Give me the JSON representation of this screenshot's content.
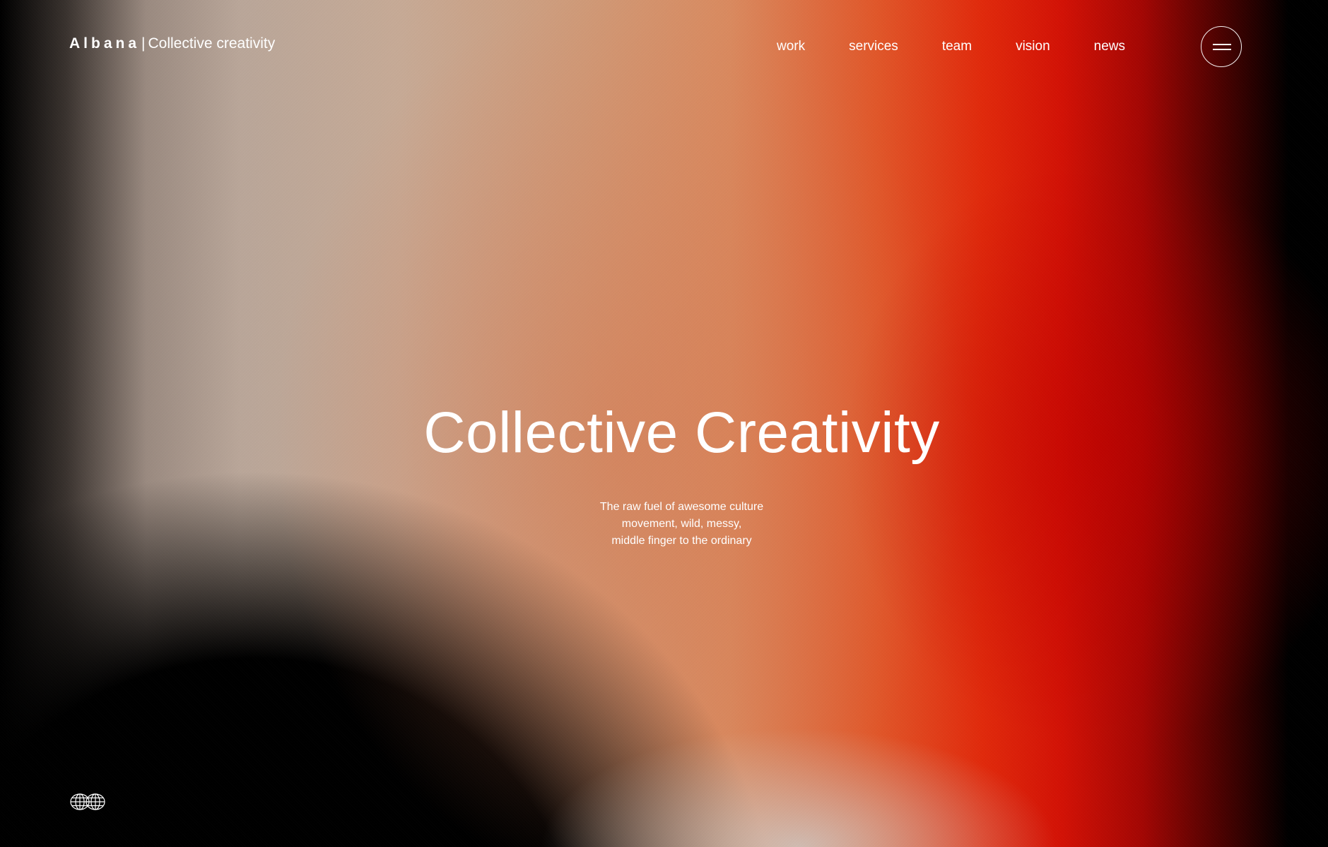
{
  "header": {
    "brand_name": "Albana",
    "brand_separator": "|",
    "brand_tagline": "Collective creativity",
    "nav": [
      {
        "label": "work"
      },
      {
        "label": "services"
      },
      {
        "label": "team"
      },
      {
        "label": "vision"
      },
      {
        "label": "news"
      }
    ],
    "menu_icon": "hamburger-icon"
  },
  "hero": {
    "title": "Collective Creativity",
    "subtitle_lines": [
      "The raw fuel of awesome culture",
      "movement, wild, messy,",
      "middle finger to the ordinary"
    ]
  },
  "footer": {
    "icon": "globe-icon"
  },
  "colors": {
    "text": "#ffffff",
    "accent_red": "#e02a0c",
    "dark": "#000000",
    "warm_mid": "#d98a5f",
    "neutral_light": "#c6aa96"
  }
}
